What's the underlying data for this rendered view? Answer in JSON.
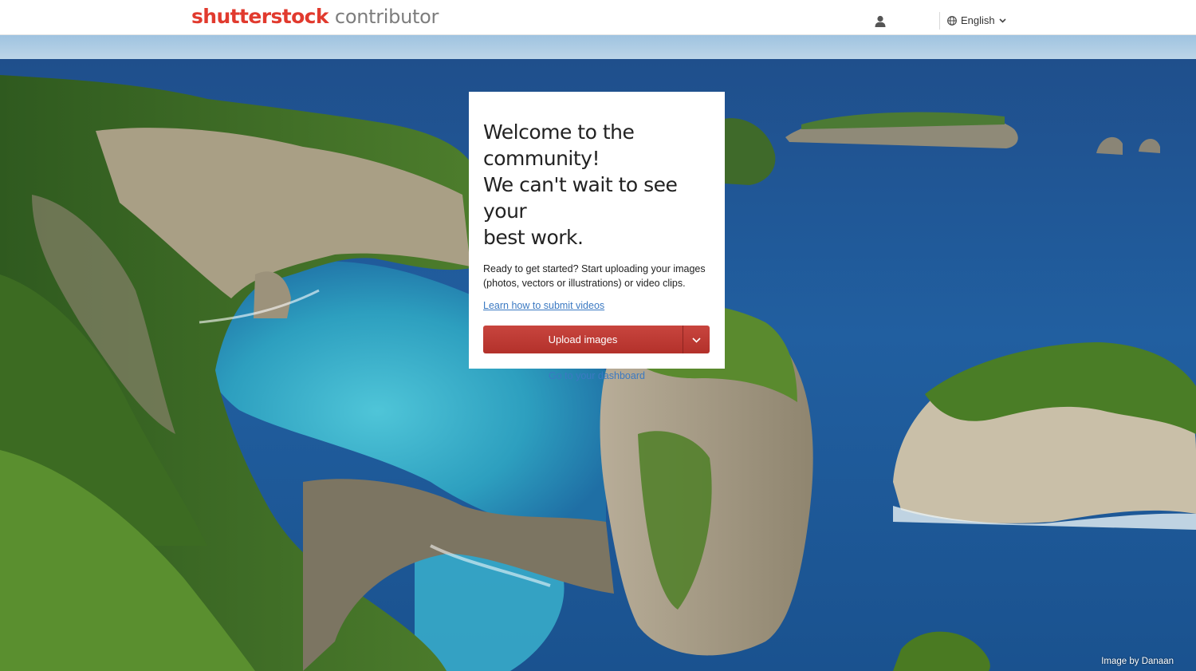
{
  "header": {
    "brand": "shutterstock",
    "product": "contributor",
    "language": "English",
    "icons": {
      "user": "user-icon",
      "globe": "globe-icon",
      "chevron": "chevron-down-icon"
    }
  },
  "card": {
    "heading_lines": [
      "Welcome to the",
      "community!",
      "We can't wait to see your",
      "best work."
    ],
    "intro": "Ready to get started? Start uploading your images (photos, vectors or illustrations) or video clips.",
    "learn_link": "Learn how to submit videos",
    "upload_label": "Upload images",
    "dashboard_link": "Go to your dashboard"
  },
  "credit": "Image by Danaan",
  "colors": {
    "brand_red": "#e13a2e",
    "button_red": "#b83a33",
    "link_blue": "#3b79c2"
  }
}
